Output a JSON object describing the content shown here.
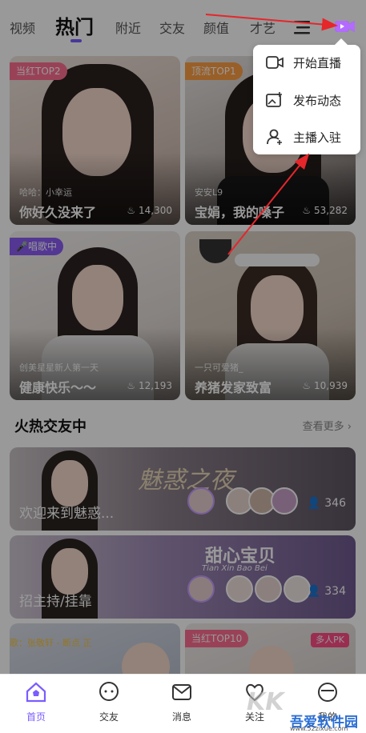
{
  "tabs": [
    "视频",
    "热门",
    "附近",
    "交友",
    "颜值",
    "才艺"
  ],
  "popup_menu": [
    "开始直播",
    "发布动态",
    "主播入驻"
  ],
  "cards": [
    {
      "tag": "当红TOP2",
      "sub": "",
      "title": "你好久没来了",
      "heat": "14,300",
      "sub2": "哈哈：小幸运"
    },
    {
      "tag": "顶流TOP1",
      "sub": "安安L9",
      "title": "宝娟，我的嗓子",
      "heat": "53,282"
    },
    {
      "tag": "唱歌中",
      "sub": "创美星星新人第一天",
      "title": "健康快乐～～",
      "heat": "12,193"
    },
    {
      "tag": "",
      "sub": "一只可爱猪_",
      "title": "养猪发家致富",
      "heat": "10,939"
    }
  ],
  "section": {
    "title": "火热交友中",
    "more": "查看更多"
  },
  "banners": [
    {
      "title": "欢迎来到魅惑...",
      "count": "346",
      "art": "魅惑之夜"
    },
    {
      "title": "招主持/挂靠",
      "count": "334",
      "art": "甜心宝贝",
      "art_sub": "Tian Xin Bao Bei"
    }
  ],
  "bottom_partial": {
    "left_text": "歌：张敬轩 - 断点 正",
    "right_tag": "当红TOP10",
    "pk": "多人PK"
  },
  "bottom_nav": [
    "首页",
    "交友",
    "消息",
    "关注",
    "我的"
  ],
  "watermark": {
    "text": "吾爱软件园",
    "url": "www.52zixue.com"
  },
  "colors": {
    "accent": "#7b5cff",
    "tag_pink": "#ff6f91",
    "tag_orange": "#ff9f43",
    "tag_purple": "#8b5cf6",
    "arrow": "#e5262b"
  }
}
